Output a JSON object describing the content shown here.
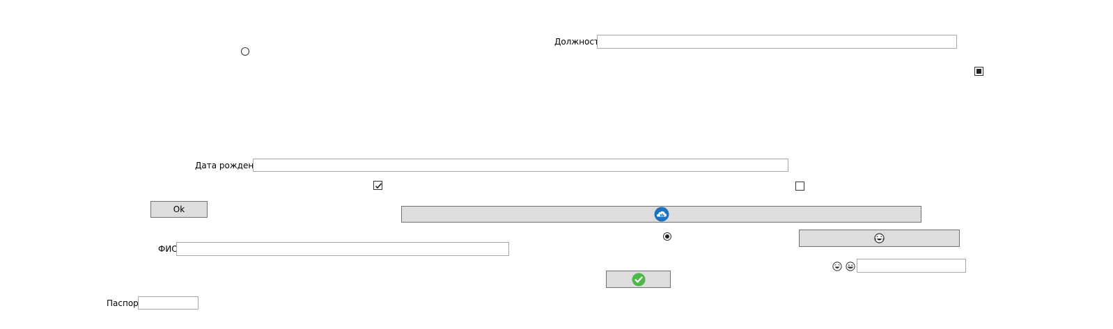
{
  "form": {
    "position_label": "Должность",
    "position_value": "",
    "birthdate_label": "Дата рождения",
    "birthdate_value": "",
    "fio_label": "ФИО",
    "fio_value": "",
    "passport_label": "Паспорт",
    "passport_value": "",
    "extra_value": ""
  },
  "buttons": {
    "ok_label": "Ok",
    "cloud_button_icon": "cloud-icon",
    "laugh_button_icon": "laughing-face-icon",
    "check_button_icon": "green-checkmark-icon"
  },
  "states": {
    "radio_top": "unchecked",
    "radio_middle": "checked",
    "checkbox_top_right": "indeterminate",
    "checkbox_left": "checked",
    "checkbox_right": "unchecked"
  },
  "icons": {
    "small_face_1": "laughing-face-icon",
    "small_face_2": "grinning-face-icon"
  },
  "colors": {
    "button_bg": "#dddddd",
    "button_border": "#707070",
    "input_border": "#a8a8a8",
    "cloud_blue": "#1e73be",
    "check_green": "#4cb848"
  }
}
